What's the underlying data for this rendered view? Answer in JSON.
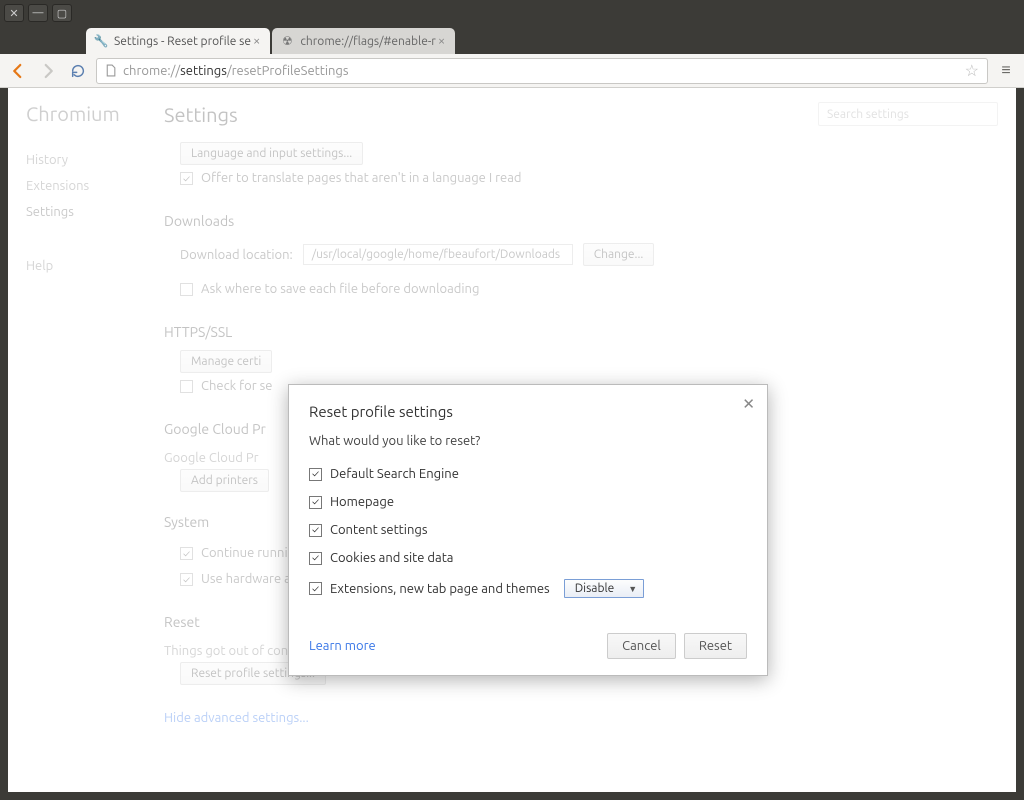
{
  "window_controls": {
    "close": "✕",
    "min": "—",
    "max": "▢"
  },
  "tabs": [
    {
      "title": "Settings - Reset profile se",
      "active": true
    },
    {
      "title": "chrome://flags/#enable-r",
      "active": false
    }
  ],
  "url": {
    "scheme": "chrome://",
    "host": "settings",
    "path": "/resetProfileSettings"
  },
  "sidebar": {
    "brand": "Chromium",
    "items": [
      "History",
      "Extensions",
      "Settings"
    ],
    "help": "Help"
  },
  "header": {
    "title": "Settings",
    "search_placeholder": "Search settings"
  },
  "lang_section": {
    "button": "Language and input settings...",
    "offer_translate": "Offer to translate pages that aren't in a language I read"
  },
  "downloads": {
    "heading": "Downloads",
    "location_label": "Download location:",
    "location_value": "/usr/local/google/home/fbeaufort/Downloads",
    "change_btn": "Change...",
    "ask_where": "Ask where to save each file before downloading"
  },
  "https": {
    "heading": "HTTPS/SSL",
    "manage_btn": "Manage certi",
    "check_revocation": "Check for se"
  },
  "gcp": {
    "heading": "Google Cloud Pr",
    "line": "Google Cloud Pr",
    "add_printers": "Add printers"
  },
  "system": {
    "heading": "System",
    "bg_apps": "Continue running background apps when Chromium is closed",
    "hw_accel": "Use hardware acceleration when available"
  },
  "reset": {
    "heading": "Reset",
    "blurb": "Things got out of control? Revert your Chrome profile to a clean, post install state.",
    "button": "Reset profile settings..."
  },
  "hide_advanced": "Hide advanced settings...",
  "modal": {
    "title": "Reset profile settings",
    "subtitle": "What would you like to reset?",
    "options": [
      "Default Search Engine",
      "Homepage",
      "Content settings",
      "Cookies and site data",
      "Extensions, new tab page and themes"
    ],
    "select_value": "Disable",
    "learn_more": "Learn more",
    "cancel": "Cancel",
    "reset": "Reset"
  }
}
